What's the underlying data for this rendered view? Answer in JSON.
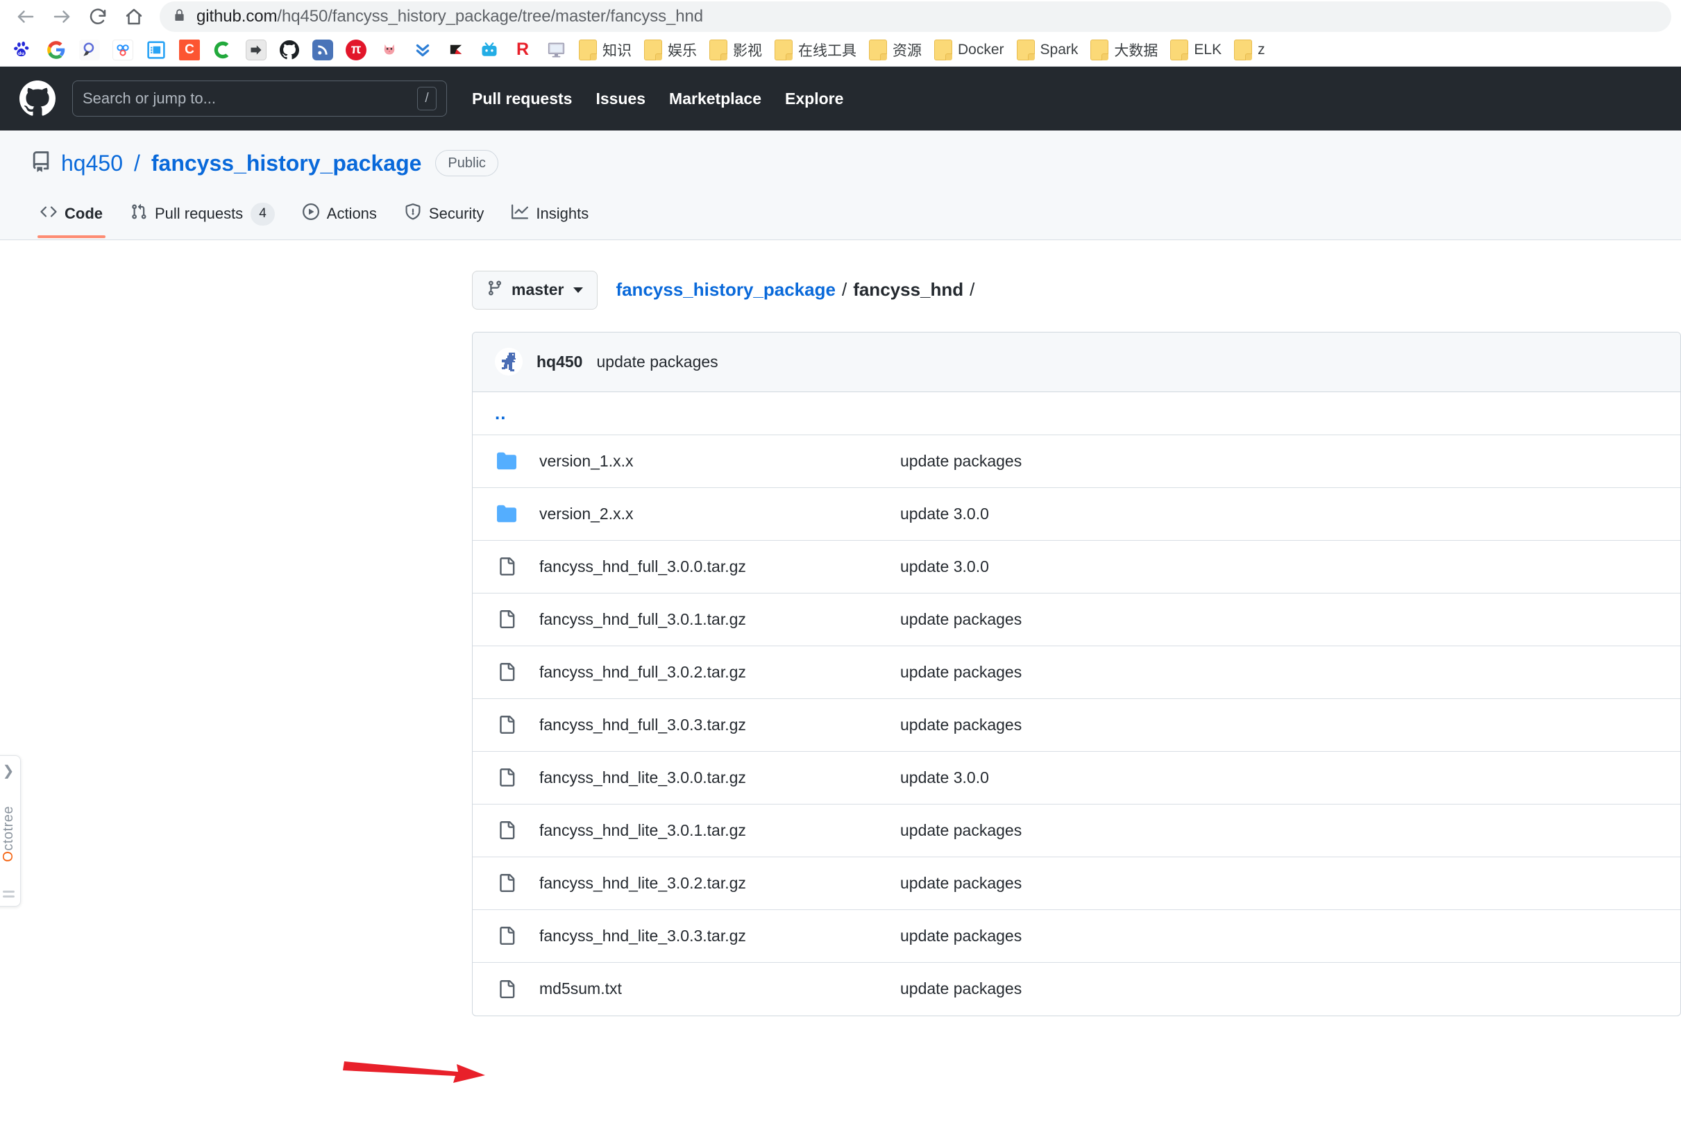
{
  "browser": {
    "back_label": "Back",
    "forward_label": "Forward",
    "reload_label": "Reload",
    "home_label": "Home",
    "url_host": "github.com",
    "url_path": "/hq450/fancyss_history_package/tree/master/fancyss_hnd",
    "lock_label": "Secure connection",
    "bookmarks": [
      {
        "icon": "baidu-icon",
        "label": ""
      },
      {
        "icon": "google-icon",
        "label": ""
      },
      {
        "icon": "search-magnifier-icon",
        "label": ""
      },
      {
        "icon": "baidu-pan-icon",
        "label": ""
      },
      {
        "icon": "blue-app-icon",
        "label": ""
      },
      {
        "icon": "csdn-icon",
        "label": ""
      },
      {
        "icon": "green-c-icon",
        "label": ""
      },
      {
        "icon": "arrow-box-icon",
        "label": ""
      },
      {
        "icon": "github-icon",
        "label": ""
      },
      {
        "icon": "rss-blue-icon",
        "label": ""
      },
      {
        "icon": "pi-red-icon",
        "label": ""
      },
      {
        "icon": "cat-icon",
        "label": ""
      },
      {
        "icon": "chevrons-down-icon",
        "label": ""
      },
      {
        "icon": "black-flag-icon",
        "label": ""
      },
      {
        "icon": "bilibili-icon",
        "label": ""
      },
      {
        "icon": "red-r-icon",
        "label": ""
      },
      {
        "icon": "monitor-icon",
        "label": ""
      },
      {
        "icon": "folder-icon",
        "label": "知识"
      },
      {
        "icon": "folder-icon",
        "label": "娱乐"
      },
      {
        "icon": "folder-icon",
        "label": "影视"
      },
      {
        "icon": "folder-icon",
        "label": "在线工具"
      },
      {
        "icon": "folder-icon",
        "label": "资源"
      },
      {
        "icon": "folder-icon",
        "label": "Docker"
      },
      {
        "icon": "folder-icon",
        "label": "Spark"
      },
      {
        "icon": "folder-icon",
        "label": "大数据"
      },
      {
        "icon": "folder-icon",
        "label": "ELK"
      },
      {
        "icon": "folder-icon",
        "label": "z"
      }
    ]
  },
  "gh_header": {
    "logo_label": "GitHub",
    "search_placeholder": "Search or jump to...",
    "search_value": "",
    "slash_key": "/",
    "nav": [
      {
        "label": "Pull requests"
      },
      {
        "label": "Issues"
      },
      {
        "label": "Marketplace"
      },
      {
        "label": "Explore"
      }
    ]
  },
  "repo": {
    "owner": "hq450",
    "name": "fancyss_history_package",
    "separator": "/",
    "visibility": "Public",
    "tabs": [
      {
        "label": "Code",
        "icon": "code-icon",
        "count": "",
        "active": true
      },
      {
        "label": "Pull requests",
        "icon": "git-pull-request-icon",
        "count": "4",
        "active": false
      },
      {
        "label": "Actions",
        "icon": "play-icon",
        "count": "",
        "active": false
      },
      {
        "label": "Security",
        "icon": "shield-icon",
        "count": "",
        "active": false
      },
      {
        "label": "Insights",
        "icon": "graph-icon",
        "count": "",
        "active": false
      }
    ]
  },
  "filebrowser": {
    "branch": "master",
    "breadcrumb_root": "fancyss_history_package",
    "breadcrumb_current": "fancyss_hnd",
    "breadcrumb_separator": "/",
    "commit": {
      "author": "hq450",
      "message": "update packages",
      "avatar_label": "hq450 avatar"
    },
    "parent_dir": "..",
    "rows": [
      {
        "type": "dir",
        "name": "version_1.x.x",
        "message": "update packages"
      },
      {
        "type": "dir",
        "name": "version_2.x.x",
        "message": "update 3.0.0"
      },
      {
        "type": "file",
        "name": "fancyss_hnd_full_3.0.0.tar.gz",
        "message": "update 3.0.0"
      },
      {
        "type": "file",
        "name": "fancyss_hnd_full_3.0.1.tar.gz",
        "message": "update packages"
      },
      {
        "type": "file",
        "name": "fancyss_hnd_full_3.0.2.tar.gz",
        "message": "update packages"
      },
      {
        "type": "file",
        "name": "fancyss_hnd_full_3.0.3.tar.gz",
        "message": "update packages"
      },
      {
        "type": "file",
        "name": "fancyss_hnd_lite_3.0.0.tar.gz",
        "message": "update 3.0.0"
      },
      {
        "type": "file",
        "name": "fancyss_hnd_lite_3.0.1.tar.gz",
        "message": "update packages"
      },
      {
        "type": "file",
        "name": "fancyss_hnd_lite_3.0.2.tar.gz",
        "message": "update packages"
      },
      {
        "type": "file",
        "name": "fancyss_hnd_lite_3.0.3.tar.gz",
        "message": "update packages"
      },
      {
        "type": "file",
        "name": "md5sum.txt",
        "message": "update packages"
      }
    ]
  },
  "octotree": {
    "label": "ctotree",
    "label_initial": "O",
    "chevron": "❯"
  },
  "annotation": {
    "arrow_color": "#e8202a",
    "points_at": "fancyss_hnd_full_3.0.3.tar.gz"
  },
  "colors": {
    "header_bg": "#24292f",
    "link_blue": "#0969da",
    "accent_orange": "#fd8c73",
    "folder_blue": "#54aeff",
    "border": "#d0d7de",
    "subtle_bg": "#f6f8fa"
  }
}
